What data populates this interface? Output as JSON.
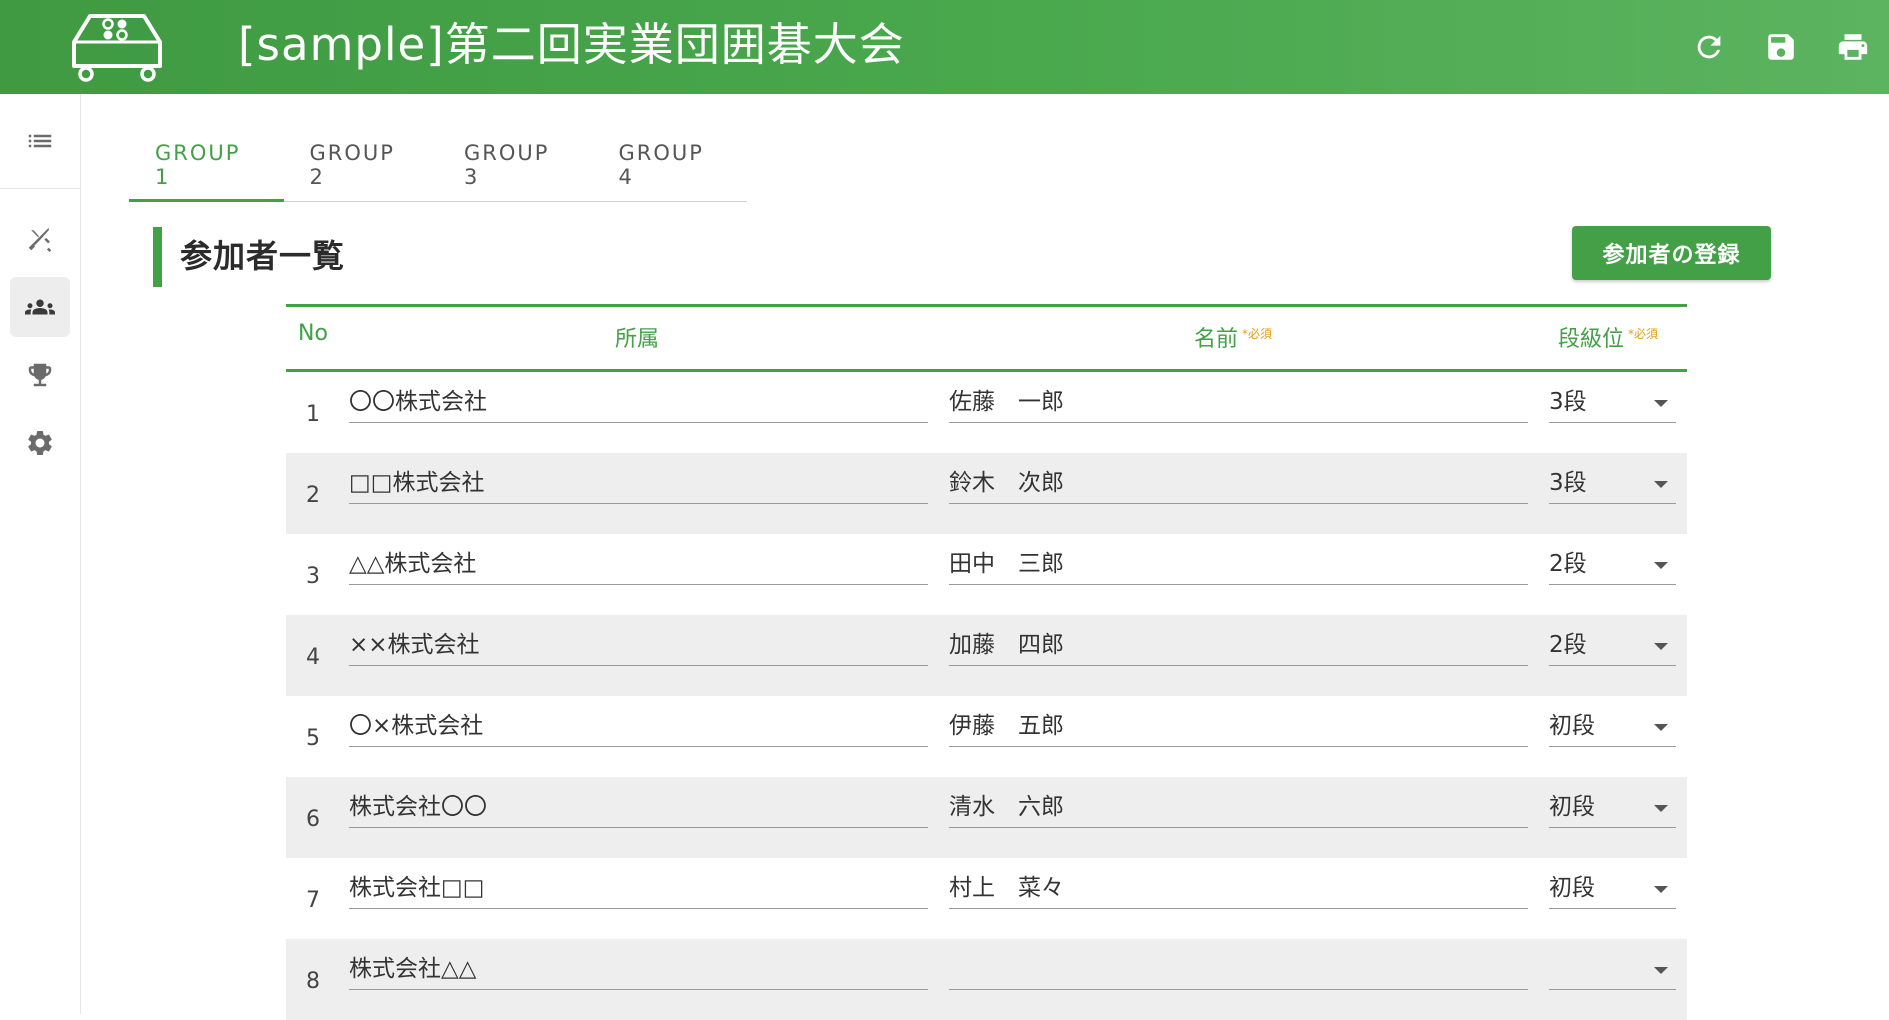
{
  "header": {
    "title": "[sample]第二回実業団囲碁大会",
    "actions": [
      {
        "name": "refresh-button",
        "icon": "refresh-icon"
      },
      {
        "name": "save-button",
        "icon": "save-icon"
      },
      {
        "name": "print-button",
        "icon": "print-icon"
      }
    ]
  },
  "sidebar": {
    "top_icon": "list-icon",
    "items": [
      {
        "name": "matches",
        "icon": "crossed-swords-icon",
        "active": false
      },
      {
        "name": "participants",
        "icon": "people-icon",
        "active": true
      },
      {
        "name": "results",
        "icon": "trophy-icon",
        "active": false
      },
      {
        "name": "settings",
        "icon": "gear-icon",
        "active": false
      }
    ]
  },
  "tabs": [
    {
      "label": "GROUP 1",
      "active": true
    },
    {
      "label": "GROUP 2",
      "active": false
    },
    {
      "label": "GROUP 3",
      "active": false
    },
    {
      "label": "GROUP 4",
      "active": false
    }
  ],
  "section": {
    "title": "参加者一覧",
    "register_label": "参加者の登録"
  },
  "table": {
    "headers": {
      "no": "No",
      "org": "所属",
      "name": "名前",
      "name_required": "*必須",
      "rank": "段級位",
      "rank_required": "*必須"
    },
    "rows": [
      {
        "no": "1",
        "org": "〇〇株式会社",
        "name": "佐藤　一郎",
        "rank": "3段"
      },
      {
        "no": "2",
        "org": "□□株式会社",
        "name": "鈴木　次郎",
        "rank": "3段"
      },
      {
        "no": "3",
        "org": "△△株式会社",
        "name": "田中　三郎",
        "rank": "2段"
      },
      {
        "no": "4",
        "org": "××株式会社",
        "name": "加藤　四郎",
        "rank": "2段"
      },
      {
        "no": "5",
        "org": "〇×株式会社",
        "name": "伊藤　五郎",
        "rank": "初段"
      },
      {
        "no": "6",
        "org": "株式会社〇〇",
        "name": "清水　六郎",
        "rank": "初段"
      },
      {
        "no": "7",
        "org": "株式会社□□",
        "name": "村上　菜々",
        "rank": "初段"
      },
      {
        "no": "8",
        "org": "株式会社△△",
        "name": "",
        "rank": ""
      }
    ]
  },
  "colors": {
    "primary": "#43a047",
    "required": "#e0a020",
    "row_alt": "#eeeeee"
  }
}
